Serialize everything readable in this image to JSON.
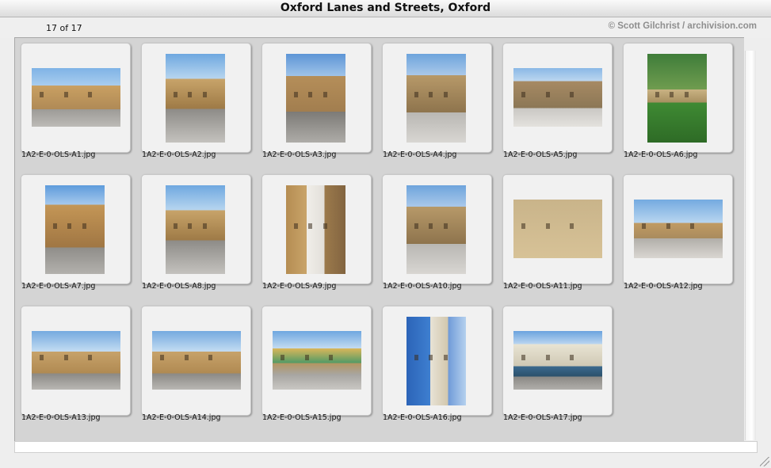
{
  "window": {
    "title": "Oxford Lanes and Streets, Oxford"
  },
  "toolbar": {
    "counter": "17 of 17",
    "credit": "© Scott Gilchrist / archivision.com"
  },
  "thumbnails": [
    {
      "filename": "1A2-E-0-OLS-A1.jpg",
      "orientation": "landscape",
      "palette": "sky-street"
    },
    {
      "filename": "1A2-E-0-OLS-A2.jpg",
      "orientation": "portrait",
      "palette": "stone-lane"
    },
    {
      "filename": "1A2-E-0-OLS-A3.jpg",
      "orientation": "portrait",
      "palette": "gate"
    },
    {
      "filename": "1A2-E-0-OLS-A4.jpg",
      "orientation": "portrait",
      "palette": "arch"
    },
    {
      "filename": "1A2-E-0-OLS-A5.jpg",
      "orientation": "landscape",
      "palette": "walls"
    },
    {
      "filename": "1A2-E-0-OLS-A6.jpg",
      "orientation": "portrait",
      "palette": "garden"
    },
    {
      "filename": "1A2-E-0-OLS-A7.jpg",
      "orientation": "portrait",
      "palette": "tall"
    },
    {
      "filename": "1A2-E-0-OLS-A8.jpg",
      "orientation": "portrait",
      "palette": "stone-lane"
    },
    {
      "filename": "1A2-E-0-OLS-A9.jpg",
      "orientation": "portrait",
      "palette": "narrow"
    },
    {
      "filename": "1A2-E-0-OLS-A10.jpg",
      "orientation": "portrait",
      "palette": "arch"
    },
    {
      "filename": "1A2-E-0-OLS-A11.jpg",
      "orientation": "landscape",
      "palette": "sign"
    },
    {
      "filename": "1A2-E-0-OLS-A12.jpg",
      "orientation": "landscape",
      "palette": "square"
    },
    {
      "filename": "1A2-E-0-OLS-A13.jpg",
      "orientation": "landscape",
      "palette": "town"
    },
    {
      "filename": "1A2-E-0-OLS-A14.jpg",
      "orientation": "landscape",
      "palette": "town"
    },
    {
      "filename": "1A2-E-0-OLS-A15.jpg",
      "orientation": "landscape",
      "palette": "colorful"
    },
    {
      "filename": "1A2-E-0-OLS-A16.jpg",
      "orientation": "portrait",
      "palette": "blue-house"
    },
    {
      "filename": "1A2-E-0-OLS-A17.jpg",
      "orientation": "landscape",
      "palette": "corner"
    }
  ],
  "colors": {
    "panel": "#d4d4d4",
    "credit_text": "#8e8e8e"
  }
}
